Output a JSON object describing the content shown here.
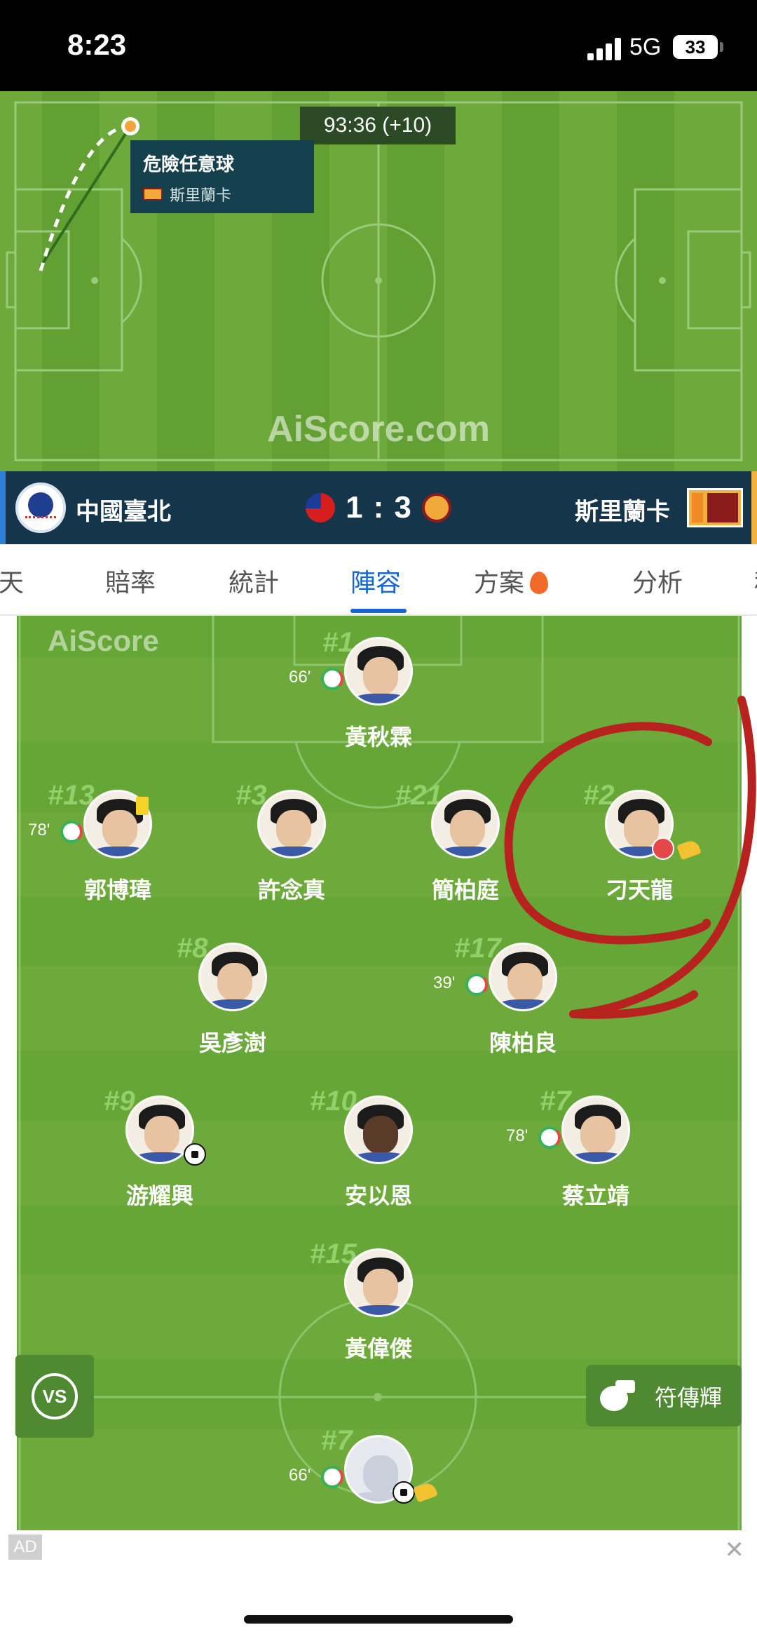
{
  "status_bar": {
    "time": "8:23",
    "network": "5G",
    "battery": "33"
  },
  "match_tracker": {
    "timer": "93:36 (+10)",
    "event": {
      "title": "危險任意球",
      "team": "斯里蘭卡"
    },
    "watermark": "AiScore.com"
  },
  "scoreboard": {
    "home_team": "中國臺北",
    "away_team": "斯里蘭卡",
    "home_score": "1",
    "separator": ":",
    "away_score": "3"
  },
  "tabs": [
    {
      "label": "聊天",
      "active": false
    },
    {
      "label": "賠率",
      "active": false
    },
    {
      "label": "統計",
      "active": false
    },
    {
      "label": "陣容",
      "active": true
    },
    {
      "label": "方案",
      "active": false
    },
    {
      "label": "分析",
      "active": false
    },
    {
      "label": "積",
      "active": false
    }
  ],
  "lineup": {
    "brand": "AiScore",
    "players": [
      {
        "number": "#1",
        "name": "黃秋霖",
        "sub_time": "66'"
      },
      {
        "number": "#13",
        "name": "郭博瑋",
        "sub_time": "78'"
      },
      {
        "number": "#3",
        "name": "許念真"
      },
      {
        "number": "#21",
        "name": "簡柏庭"
      },
      {
        "number": "#2",
        "name": "刁天龍"
      },
      {
        "number": "#8",
        "name": "吳彥澍"
      },
      {
        "number": "#17",
        "name": "陳柏良",
        "sub_time": "39'"
      },
      {
        "number": "#9",
        "name": "游耀興"
      },
      {
        "number": "#10",
        "name": "安以恩"
      },
      {
        "number": "#7",
        "name": "蔡立靖",
        "sub_time": "78'"
      },
      {
        "number": "#15",
        "name": "黃偉傑"
      },
      {
        "number": "#7",
        "sub_time": "66'"
      }
    ],
    "vs_label": "VS",
    "referee": "符傳輝"
  },
  "ad": {
    "label": "AD",
    "close": "✕"
  }
}
